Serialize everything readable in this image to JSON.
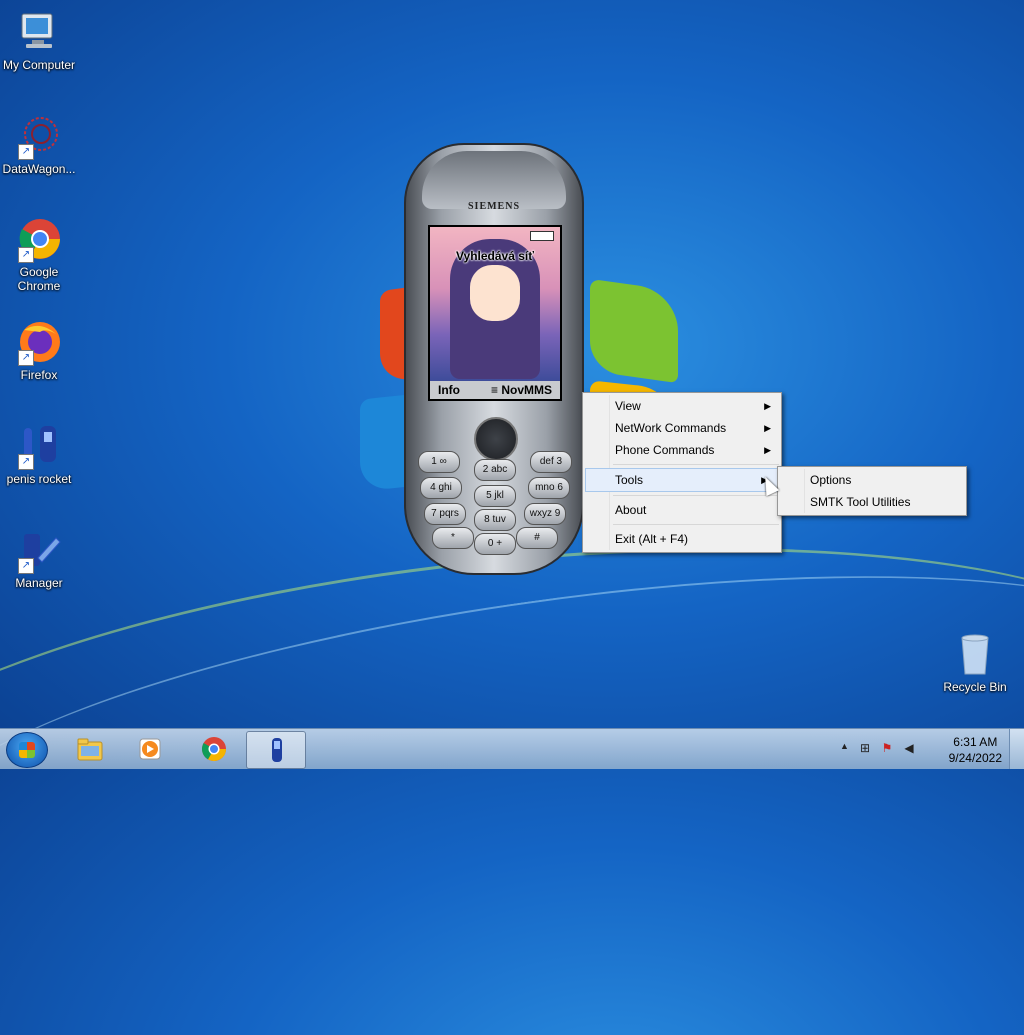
{
  "desktop": {
    "icons": [
      {
        "label": "My Computer",
        "icon": "computer-icon"
      },
      {
        "label": "DataWagon...",
        "icon": "datawagon-icon"
      },
      {
        "label": "Google Chrome",
        "icon": "chrome-icon"
      },
      {
        "label": "Firefox",
        "icon": "firefox-icon"
      },
      {
        "label": "penis rocket",
        "icon": "rocket-icon"
      },
      {
        "label": "Manager",
        "icon": "manager-icon"
      },
      {
        "label": "Recycle Bin",
        "icon": "recycle-bin-icon"
      }
    ]
  },
  "phone": {
    "brand": "SIEMENS",
    "status": "Vyhledává síť",
    "softkey_left": "Info",
    "softkey_right": "NovMMS",
    "menu_glyph": "≡",
    "keys": [
      "1 ∞",
      "2 abc",
      "def 3",
      "4 ghi",
      "5 jkl",
      "mno 6",
      "7 pqrs",
      "8 tuv",
      "wxyz 9",
      "*",
      "0 +",
      "#"
    ]
  },
  "context_menu": {
    "items": [
      {
        "label": "View",
        "submenu": true
      },
      {
        "label": "NetWork Commands",
        "submenu": true
      },
      {
        "label": "Phone Commands",
        "submenu": true
      },
      {
        "label": "Tools",
        "submenu": true,
        "highlighted": true
      },
      {
        "label": "About",
        "submenu": false
      },
      {
        "label": "Exit (Alt + F4)",
        "submenu": false
      }
    ],
    "arrow_glyph": "▶"
  },
  "submenu": {
    "items": [
      {
        "label": "Options"
      },
      {
        "label": "SMTK Tool Utilities"
      }
    ]
  },
  "taskbar": {
    "apps": [
      {
        "name": "explorer",
        "icon": "folder-icon"
      },
      {
        "name": "media-player",
        "icon": "media-player-icon"
      },
      {
        "name": "chrome",
        "icon": "chrome-icon"
      },
      {
        "name": "phone-app",
        "icon": "phone-icon",
        "active": true
      }
    ],
    "tray_arrow": "▲",
    "tray_icons": [
      "network-icon",
      "action-center-icon",
      "volume-icon"
    ],
    "time": "6:31 AM",
    "date": "9/24/2022"
  }
}
